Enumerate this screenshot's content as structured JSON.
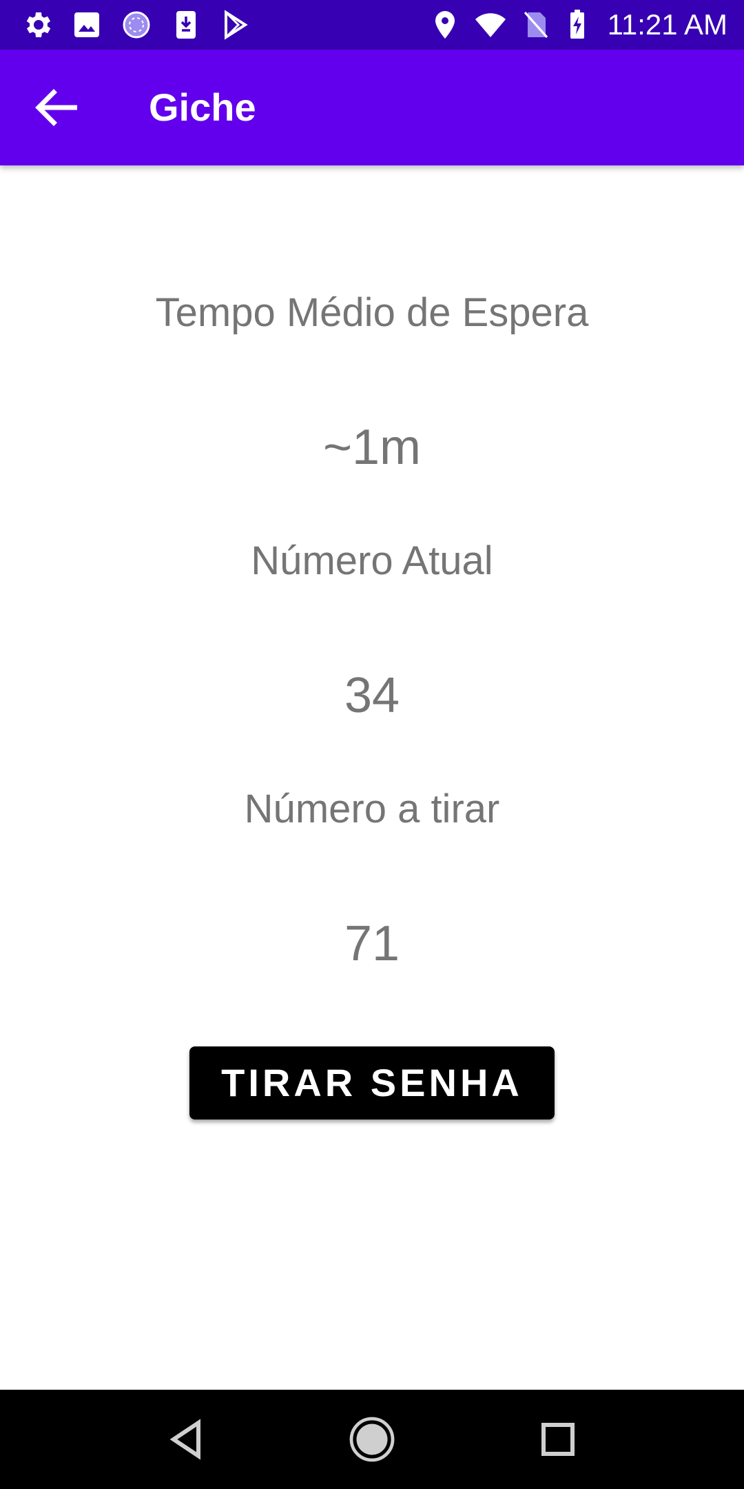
{
  "status_bar": {
    "time": "11:21 AM",
    "left_icons": [
      "gear-icon",
      "image-icon",
      "sync-circle-icon",
      "download-icon",
      "play-store-icon"
    ],
    "right_icons": [
      "location-icon",
      "wifi-icon",
      "no-sim-icon",
      "battery-charging-icon"
    ]
  },
  "app_bar": {
    "title": "Giche",
    "back_icon": "arrow-left-icon"
  },
  "main": {
    "wait_label": "Tempo Médio de Espera",
    "wait_value": "~1m",
    "current_label": "Número Atual",
    "current_value": "34",
    "next_label": "Número a tirar",
    "next_value": "71",
    "button_label": "TIRAR SENHA"
  },
  "nav_bar": {
    "icons": [
      "back-triangle-icon",
      "home-circle-icon",
      "recents-square-icon"
    ]
  },
  "colors": {
    "status_bar": "#3700b3",
    "app_bar": "#6200ee",
    "text_gray": "#757575",
    "button_bg": "#000000"
  }
}
